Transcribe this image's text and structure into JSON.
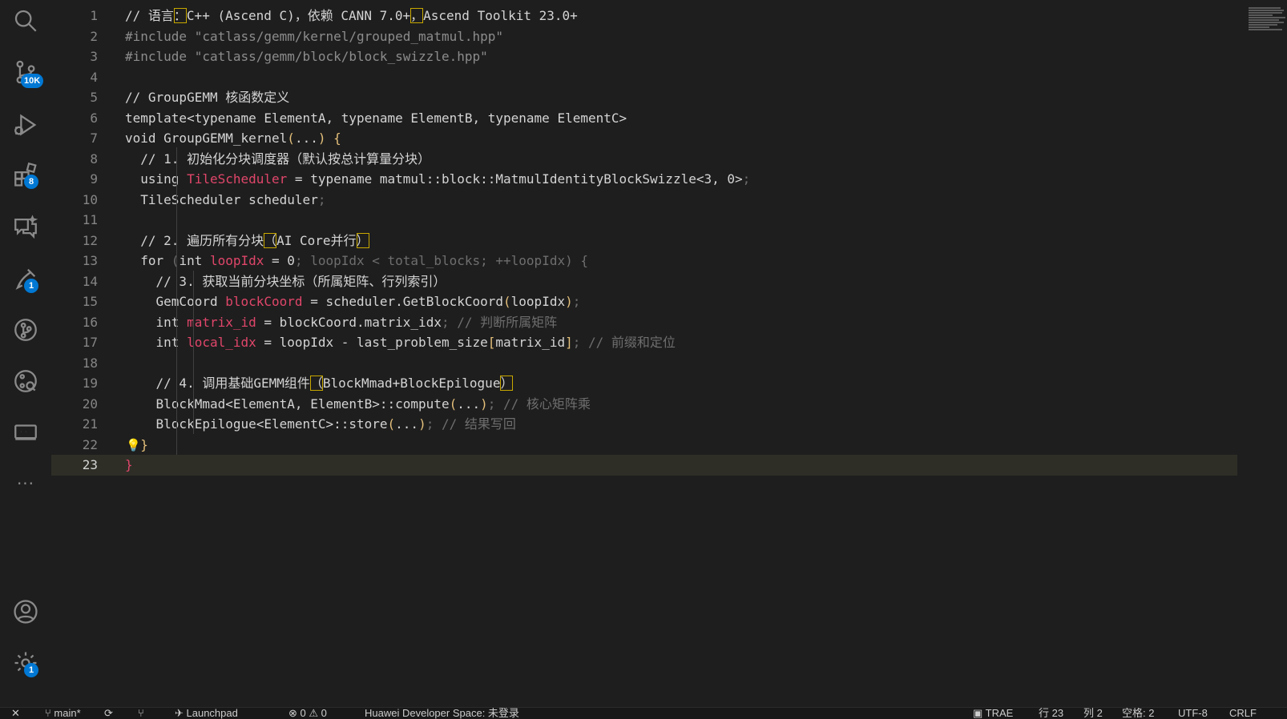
{
  "activity_bar": {
    "source_control_badge": "10K",
    "extensions_badge": "8",
    "testing_badge": "1",
    "settings_badge": "1"
  },
  "editor": {
    "lines": [
      {
        "no": "1",
        "segments": [
          [
            "tok-comment",
            "// 语言"
          ],
          [
            "box tok-comment",
            "："
          ],
          [
            "tok-comment",
            "C++ (Ascend C)，依赖 CANN 7.0+"
          ],
          [
            "box tok-comment",
            "，"
          ],
          [
            "tok-comment",
            "Ascend Toolkit 23.0+"
          ]
        ]
      },
      {
        "no": "2",
        "segments": [
          [
            "tok-inc",
            "#include \"catlass/gemm/kernel/grouped_matmul.hpp\""
          ]
        ]
      },
      {
        "no": "3",
        "segments": [
          [
            "tok-inc",
            "#include \"catlass/gemm/block/block_swizzle.hpp\""
          ]
        ]
      },
      {
        "no": "4",
        "segments": []
      },
      {
        "no": "5",
        "segments": [
          [
            "tok-comment",
            "// GroupGEMM 核函数定义"
          ]
        ]
      },
      {
        "no": "6",
        "segments": [
          [
            "",
            "template<typename ElementA, typename ElementB, typename ElementC>"
          ]
        ]
      },
      {
        "no": "7",
        "segments": [
          [
            "",
            "void GroupGEMM_kernel"
          ],
          [
            "tok-brk",
            "("
          ],
          [
            "",
            "..."
          ],
          [
            "tok-brk",
            ")"
          ],
          [
            "",
            " "
          ],
          [
            "tok-brk",
            "{"
          ]
        ]
      },
      {
        "no": "8",
        "segments": [
          [
            "",
            "  // 1. 初始化分块调度器（默认按总计算量分块）"
          ]
        ]
      },
      {
        "no": "9",
        "segments": [
          [
            "",
            "  using "
          ],
          [
            "tok-var",
            "TileScheduler"
          ],
          [
            "",
            " = typename matmul::block::MatmulIdentityBlockSwizzle<3, 0>"
          ],
          [
            "tok-dim",
            ";"
          ]
        ]
      },
      {
        "no": "10",
        "segments": [
          [
            "",
            "  TileScheduler scheduler"
          ],
          [
            "tok-dim",
            ";"
          ]
        ]
      },
      {
        "no": "11",
        "segments": []
      },
      {
        "no": "12",
        "segments": [
          [
            "",
            "  // 2. 遍历所有分块"
          ],
          [
            "box",
            "（"
          ],
          [
            "",
            "AI Core并行"
          ],
          [
            "box",
            "）"
          ]
        ]
      },
      {
        "no": "13",
        "segments": [
          [
            "",
            "  for "
          ],
          [
            "tok-dim",
            "("
          ],
          [
            "",
            "int "
          ],
          [
            "tok-var",
            "loopIdx"
          ],
          [
            "",
            " = 0"
          ],
          [
            "tok-dim",
            "; loopIdx < total_blocks; ++loopIdx) {"
          ]
        ]
      },
      {
        "no": "14",
        "segments": [
          [
            "",
            "    // 3. 获取当前分块坐标（所属矩阵、行列索引）"
          ]
        ]
      },
      {
        "no": "15",
        "segments": [
          [
            "",
            "    GemCoord "
          ],
          [
            "tok-var",
            "blockCoord"
          ],
          [
            "",
            " = scheduler.GetBlockCoord"
          ],
          [
            "tok-brk",
            "("
          ],
          [
            "",
            "loopIdx"
          ],
          [
            "tok-brk",
            ")"
          ],
          [
            "tok-dim",
            ";"
          ]
        ]
      },
      {
        "no": "16",
        "segments": [
          [
            "",
            "    int "
          ],
          [
            "tok-var",
            "matrix_id"
          ],
          [
            "",
            " = blockCoord.matrix_idx"
          ],
          [
            "tok-dim",
            "; // 判断所属矩阵"
          ]
        ]
      },
      {
        "no": "17",
        "segments": [
          [
            "",
            "    int "
          ],
          [
            "tok-var",
            "local_idx"
          ],
          [
            "",
            " = loopIdx - last_problem_size"
          ],
          [
            "tok-brk",
            "["
          ],
          [
            "",
            "matrix_id"
          ],
          [
            "tok-brk",
            "]"
          ],
          [
            "tok-dim",
            "; // 前缀和定位"
          ]
        ]
      },
      {
        "no": "18",
        "segments": []
      },
      {
        "no": "19",
        "segments": [
          [
            "",
            "    // 4. 调用基础GEMM组件"
          ],
          [
            "box",
            "（"
          ],
          [
            "",
            "BlockMmad+BlockEpilogue"
          ],
          [
            "box",
            "）"
          ]
        ]
      },
      {
        "no": "20",
        "segments": [
          [
            "",
            "    BlockMmad<ElementA, ElementB>::compute"
          ],
          [
            "tok-brk",
            "("
          ],
          [
            "",
            "..."
          ],
          [
            "tok-brk",
            ")"
          ],
          [
            "tok-dim",
            "; // 核心矩阵乘"
          ]
        ]
      },
      {
        "no": "21",
        "segments": [
          [
            "",
            "    BlockEpilogue<ElementC>::store"
          ],
          [
            "tok-brk",
            "("
          ],
          [
            "",
            "..."
          ],
          [
            "tok-brk",
            ")"
          ],
          [
            "tok-dim",
            "; // 结果写回"
          ]
        ]
      },
      {
        "no": "22",
        "segments": [
          [
            "",
            "  "
          ],
          [
            "tok-brk",
            "}"
          ]
        ]
      },
      {
        "no": "23",
        "segments": [
          [
            "tok-red",
            "}"
          ]
        ]
      }
    ]
  },
  "statusbar": {
    "branch": "main*",
    "launchpad": "Launchpad",
    "errors": "0",
    "warnings": "0",
    "space_info": "Huawei Developer Space: 未登录",
    "trae": "TRAE",
    "position_line": "行 23",
    "position_col": "列 2",
    "indent": "空格: 2",
    "encoding": "UTF-8",
    "eol": "CRLF"
  }
}
